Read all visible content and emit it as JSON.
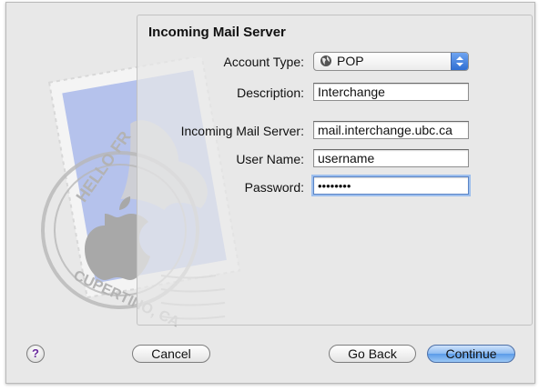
{
  "section_title": "Incoming Mail Server",
  "form": {
    "account_type_label": "Account Type:",
    "account_type_value": "POP",
    "description_label": "Description:",
    "description_value": "Interchange",
    "server_label": "Incoming Mail Server:",
    "server_value": "mail.interchange.ubc.ca",
    "username_label": "User Name:",
    "username_value": "username",
    "password_label": "Password:",
    "password_value": "••••••••"
  },
  "stamp": {
    "text_top": "HELLO FR",
    "text_bottom": "CUPERTINO, CA"
  },
  "buttons": {
    "help": "?",
    "cancel": "Cancel",
    "go_back": "Go Back",
    "continue": "Continue"
  },
  "icons": {
    "account_type": "globe-icon",
    "help": "help-icon"
  },
  "colors": {
    "primary_button": "#5b9be8",
    "focus_ring": "#9ec0ee",
    "stamp_blue": "#a9b9ea"
  }
}
